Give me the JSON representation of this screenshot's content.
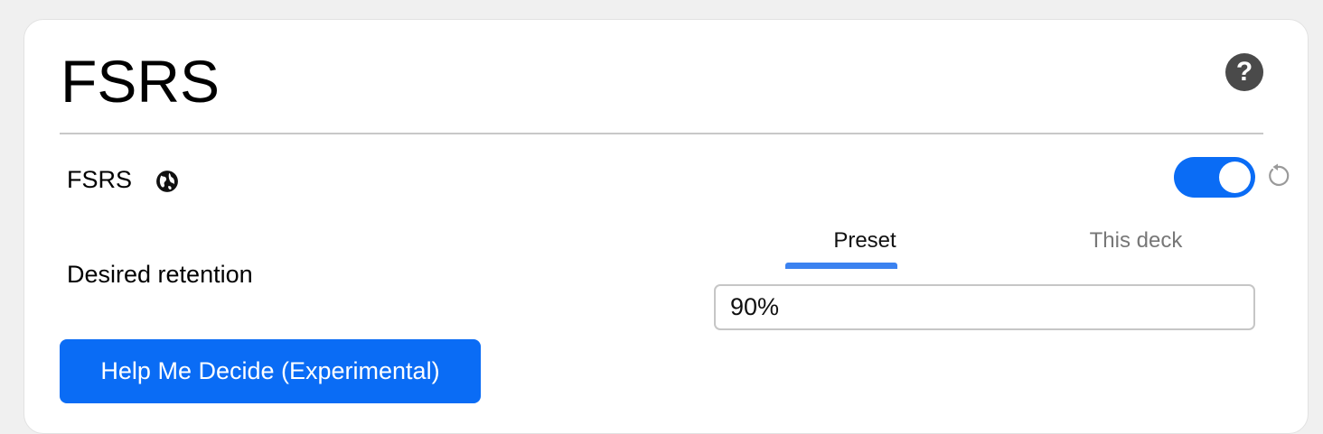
{
  "section": {
    "title": "FSRS",
    "help_icon": "question-circle-icon",
    "help_glyph": "?"
  },
  "fsrs_toggle": {
    "label": "FSRS",
    "globe_icon": "globe-icon",
    "enabled": true,
    "reset_icon": "reset-icon",
    "accent_color": "#0a6cf5"
  },
  "tabs": [
    {
      "label": "Preset",
      "active": true
    },
    {
      "label": "This deck",
      "active": false
    }
  ],
  "desired_retention": {
    "label": "Desired retention",
    "value": "90%"
  },
  "help_me_decide_button": {
    "label": "Help Me Decide (Experimental)"
  }
}
